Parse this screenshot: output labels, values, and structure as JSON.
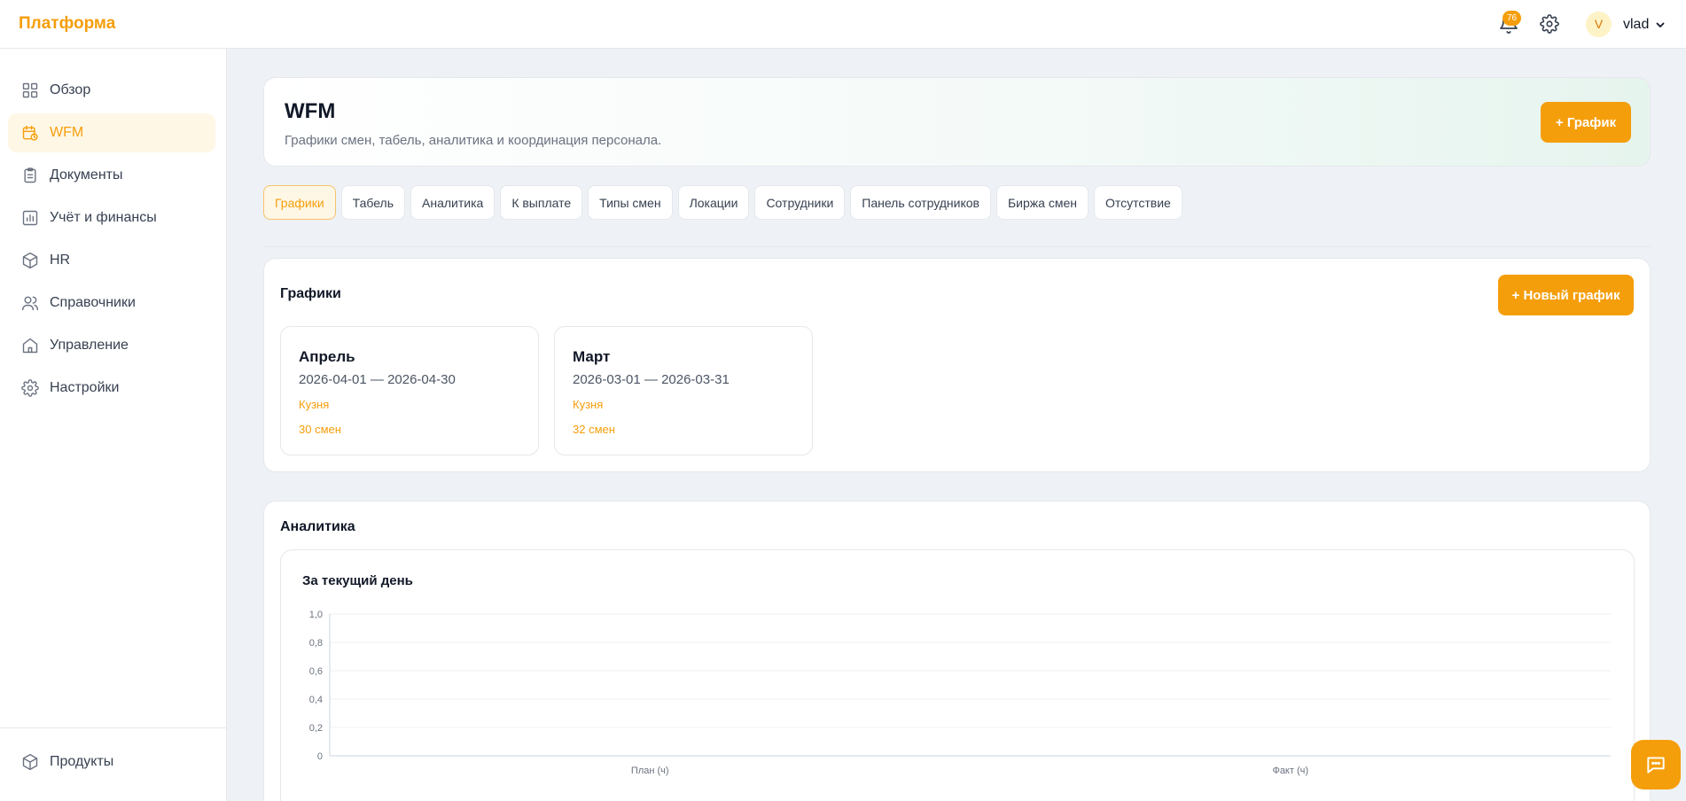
{
  "header": {
    "brand": "Платформа",
    "notifications_count": "76",
    "avatar_letter": "V",
    "username": "vlad"
  },
  "sidebar": {
    "items": [
      {
        "label": "Обзор",
        "icon": "grid-icon"
      },
      {
        "label": "WFM",
        "icon": "calendar-clock-icon",
        "active": true
      },
      {
        "label": "Документы",
        "icon": "clipboard-icon"
      },
      {
        "label": "Учёт и финансы",
        "icon": "bar-chart-icon"
      },
      {
        "label": "HR",
        "icon": "cube-icon"
      },
      {
        "label": "Справочники",
        "icon": "users-icon"
      },
      {
        "label": "Управление",
        "icon": "home-icon"
      },
      {
        "label": "Настройки",
        "icon": "gear-icon"
      }
    ],
    "bottom_item": {
      "label": "Продукты",
      "icon": "cube-icon"
    }
  },
  "hero": {
    "title": "WFM",
    "subtitle": "Графики смен, табель, аналитика и координация персонала.",
    "action_label": "+ График"
  },
  "tabs": [
    {
      "label": "Графики",
      "active": true
    },
    {
      "label": "Табель"
    },
    {
      "label": "Аналитика"
    },
    {
      "label": "К выплате"
    },
    {
      "label": "Типы смен"
    },
    {
      "label": "Локации"
    },
    {
      "label": "Сотрудники"
    },
    {
      "label": "Панель сотрудников"
    },
    {
      "label": "Биржа смен"
    },
    {
      "label": "Отсутствие"
    }
  ],
  "schedules": {
    "title": "Графики",
    "new_label": "+ Новый график",
    "items": [
      {
        "name": "Апрель",
        "dates": "2026-04-01 — 2026-04-30",
        "location": "Кузня",
        "shifts": "30 смен"
      },
      {
        "name": "Март",
        "dates": "2026-03-01 — 2026-03-31",
        "location": "Кузня",
        "shifts": "32 смен"
      }
    ]
  },
  "analytics": {
    "title": "Аналитика"
  },
  "chart_data": {
    "type": "bar",
    "title": "За текущий день",
    "categories": [
      "План (ч)",
      "Факт (ч)"
    ],
    "values": [
      0,
      0
    ],
    "ylim": [
      0,
      1
    ],
    "yticks": [
      "0",
      "0,2",
      "0,4",
      "0,6",
      "0,8",
      "1,0"
    ],
    "grid": true,
    "accent": "#f59e0b"
  },
  "colors": {
    "accent": "#f59e0b",
    "background": "#eef2f6"
  }
}
